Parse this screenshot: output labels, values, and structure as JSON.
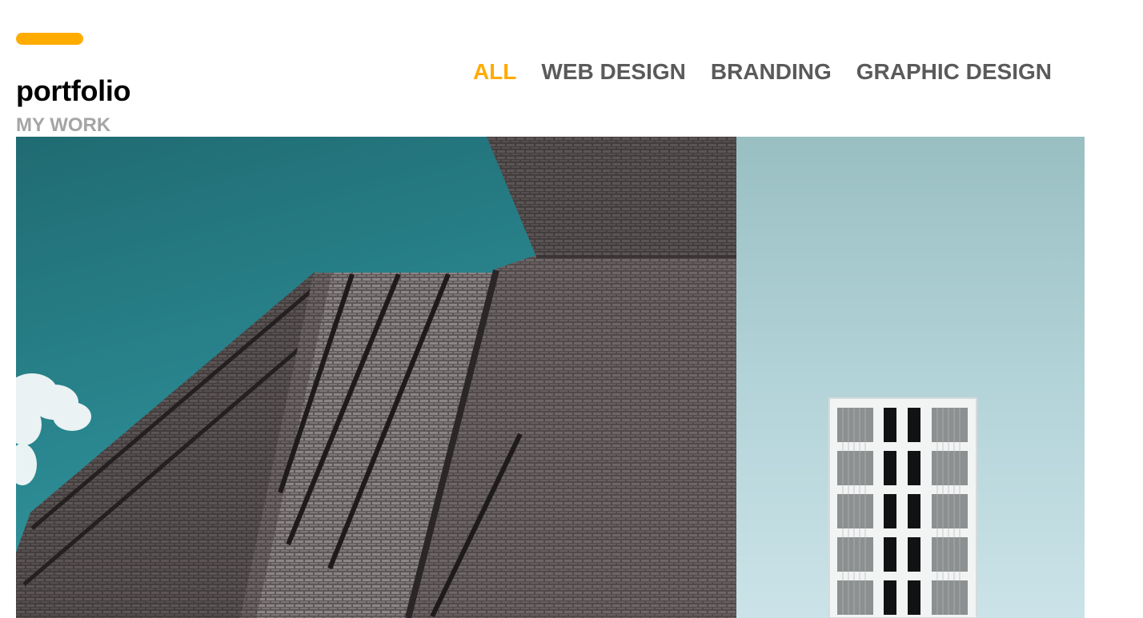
{
  "header": {
    "accent_color": "#ffab00",
    "title": "portfolio",
    "subtitle": "MY WORK"
  },
  "filters": {
    "active_index": 0,
    "items": [
      {
        "label": "ALL"
      },
      {
        "label": "WEB DESIGN"
      },
      {
        "label": "BRANDING"
      },
      {
        "label": "GRAPHIC DESIGN"
      }
    ]
  },
  "gallery": {
    "items": [
      {
        "subject": "brick-building-photo"
      },
      {
        "subject": "white-window-building-photo"
      }
    ]
  }
}
